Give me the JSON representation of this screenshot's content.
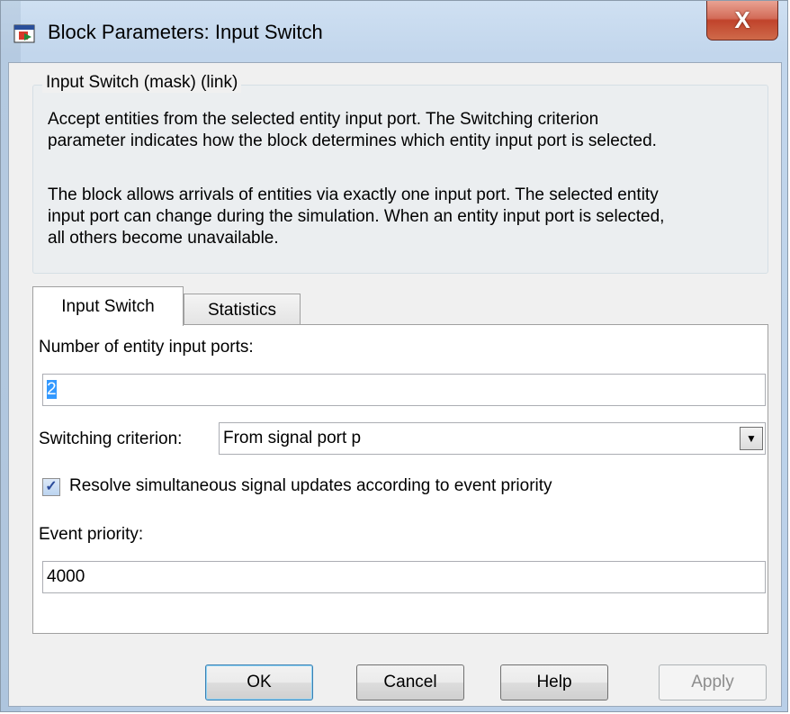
{
  "window": {
    "title": "Block Parameters: Input Switch",
    "close_label": "X"
  },
  "group": {
    "legend": "Input Switch  (mask) (link)",
    "desc_lines_1": [
      "Accept entities from the selected entity input port. The Switching criterion",
      "parameter indicates how the block determines which entity input port is selected."
    ],
    "desc_lines_2": [
      "The block allows arrivals of entities via exactly one input port. The selected entity",
      "input port can change during the simulation. When an entity input port is selected,",
      "all others become unavailable."
    ]
  },
  "tabs": [
    {
      "label": "Input Switch",
      "active": true
    },
    {
      "label": "Statistics",
      "active": false
    }
  ],
  "form": {
    "ports_label": "Number of entity input ports:",
    "ports_value": "2",
    "criterion_label": "Switching criterion:",
    "criterion_value": "From signal port p",
    "resolve_label": "Resolve simultaneous signal updates according to event priority",
    "resolve_checked": true,
    "priority_label": "Event priority:",
    "priority_value": "4000"
  },
  "buttons": {
    "ok": "OK",
    "cancel": "Cancel",
    "help": "Help",
    "apply": "Apply"
  },
  "colors": {
    "selection": "#3399ff",
    "close": "#c0432b",
    "titlebar": "#c2d6ec"
  }
}
